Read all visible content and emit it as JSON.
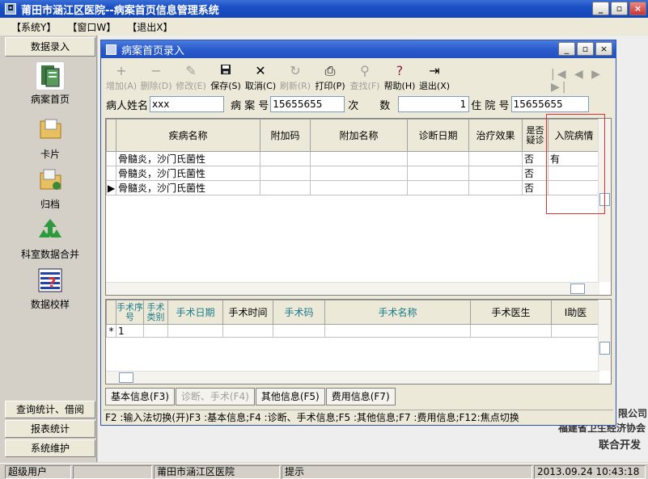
{
  "app": {
    "title": "莆田市涵江区医院--病案首页信息管理系统"
  },
  "window_buttons": {
    "min": "_",
    "max": "▫",
    "close": "×"
  },
  "menu": [
    "【系统Y】",
    "【窗口W】",
    "【退出X】"
  ],
  "left": {
    "header": "数据录入",
    "nav": [
      {
        "label": "病案首页",
        "icon": "medical-record-icon"
      },
      {
        "label": "卡片",
        "icon": "card-folder-icon"
      },
      {
        "label": "归档",
        "icon": "archive-folder-icon"
      },
      {
        "label": "科室数据合并",
        "icon": "merge-recycle-icon"
      },
      {
        "label": "数据校样",
        "icon": "data-check-icon"
      }
    ],
    "bottom": [
      "查询统计、借阅",
      "报表统计",
      "系统维护"
    ]
  },
  "child": {
    "title": "病案首页录入",
    "toolbar": [
      {
        "label": "增加(A)",
        "icon": "+",
        "enabled": false
      },
      {
        "label": "删除(D)",
        "icon": "−",
        "enabled": false
      },
      {
        "label": "修改(E)",
        "icon": "✎",
        "enabled": false
      },
      {
        "label": "保存(S)",
        "icon": "💾",
        "enabled": true
      },
      {
        "label": "取消(C)",
        "icon": "✕",
        "enabled": true
      },
      {
        "label": "刷新(R)",
        "icon": "↻",
        "enabled": false
      },
      {
        "label": "打印(P)",
        "icon": "⎙",
        "enabled": true
      },
      {
        "label": "查找(F)",
        "icon": "⚲",
        "enabled": false
      },
      {
        "label": "帮助(H)",
        "icon": "?",
        "enabled": true
      },
      {
        "label": "退出(X)",
        "icon": "⇥",
        "enabled": true
      }
    ],
    "nav_arrows": "|◀ ◀ ▶ ▶|",
    "fields": {
      "patient_name_label": "病人姓名",
      "patient_name_value": "xxx",
      "case_no_label": "病 案 号",
      "case_no_value": "15655655",
      "times_label": "次　　数",
      "times_value": "1",
      "hosp_no_label": "住 院 号",
      "hosp_no_value": "15655655"
    },
    "diag_table": {
      "columns": [
        "疾病名称",
        "附加码",
        "附加名称",
        "诊断日期",
        "治疗效果",
        "是否疑诊",
        "入院病情"
      ],
      "rows": [
        [
          "骨髓炎，沙门氏菌性",
          "",
          "",
          "",
          "",
          "否",
          "有"
        ],
        [
          "骨髓炎，沙门氏菌性",
          "",
          "",
          "",
          "",
          "否",
          ""
        ],
        [
          "骨髓炎，沙门氏菌性",
          "",
          "",
          "",
          "",
          "否",
          ""
        ]
      ]
    },
    "surg_table": {
      "columns": [
        "手术序号",
        "手术类别",
        "手术日期",
        "手术时间",
        "手术码",
        "手术名称",
        "手术医生",
        "I助医"
      ],
      "rows": [
        [
          "1",
          "",
          "",
          "",
          "",
          "",
          "",
          ""
        ]
      ]
    },
    "tabs": [
      {
        "label": "基本信息(F3)",
        "enabled": true
      },
      {
        "label": "诊断、手术(F4)",
        "enabled": false
      },
      {
        "label": "其他信息(F5)",
        "enabled": true
      },
      {
        "label": "费用信息(F7)",
        "enabled": true
      }
    ],
    "hint": "F2 :输入法切换(开)F3 :基本信息;F4 :诊断、手术信息;F5 :其他信息;F7 :费用信息;F12:焦点切换"
  },
  "background_text": [
    "限公司",
    "福建省卫生经济协会",
    "联合开发"
  ],
  "status": {
    "user": "超级用户",
    "empty": "",
    "hospital": "莆田市涵江区医院",
    "tip": "提示",
    "datetime": "2013.09.24 10:43:18"
  }
}
